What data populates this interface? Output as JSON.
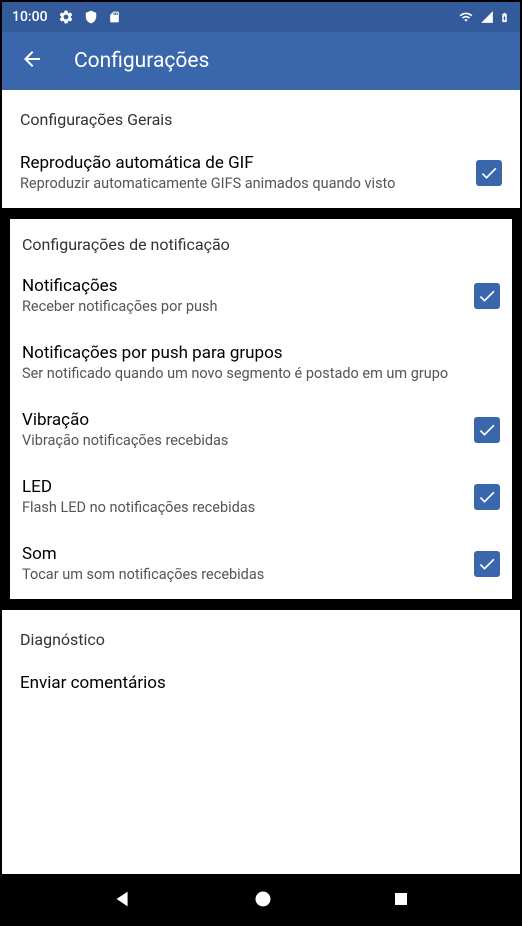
{
  "statusBar": {
    "time": "10:00"
  },
  "appBar": {
    "title": "Configurações"
  },
  "sections": {
    "general": {
      "header": "Configurações Gerais",
      "gif": {
        "title": "Reprodução automática de GIF",
        "subtitle": "Reproduzir automaticamente GIFS animados quando visto",
        "checked": true
      }
    },
    "notification": {
      "header": "Configurações de notificação",
      "notifications": {
        "title": "Notificações",
        "subtitle": "Receber notificações por push",
        "checked": true
      },
      "pushGroups": {
        "title": "Notificações por push para grupos",
        "subtitle": "Ser notificado quando um novo segmento é postado em um grupo"
      },
      "vibration": {
        "title": "Vibração",
        "subtitle": "Vibração notificações recebidas",
        "checked": true
      },
      "led": {
        "title": "LED",
        "subtitle": "Flash LED no notificações recebidas",
        "checked": true
      },
      "sound": {
        "title": "Som",
        "subtitle": "Tocar um som notificações recebidas",
        "checked": true
      }
    },
    "diagnostic": {
      "header": "Diagnóstico",
      "feedback": {
        "title": "Enviar comentários"
      }
    }
  }
}
